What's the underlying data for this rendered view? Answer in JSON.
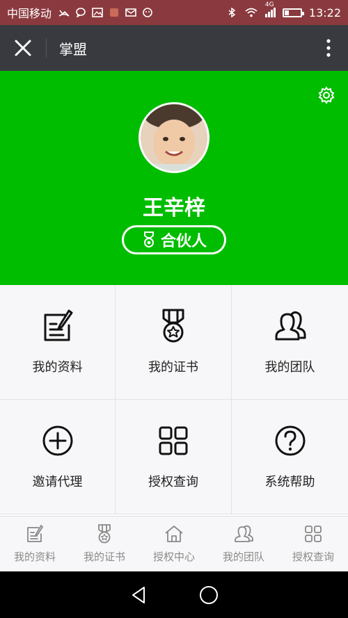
{
  "status_bar": {
    "carrier": "中国移动",
    "network": "4G",
    "time": "13:22",
    "battery_level": 0.25
  },
  "title_bar": {
    "title": "掌盟"
  },
  "profile": {
    "name": "王辛梓",
    "role": "合伙人",
    "hero_color": "#00bd00"
  },
  "grid": [
    {
      "label": "我的资料",
      "icon": "edit-icon"
    },
    {
      "label": "我的证书",
      "icon": "medal-icon"
    },
    {
      "label": "我的团队",
      "icon": "team-icon"
    },
    {
      "label": "邀请代理",
      "icon": "plus-circle-icon"
    },
    {
      "label": "授权查询",
      "icon": "grid-icon"
    },
    {
      "label": "系统帮助",
      "icon": "help-icon"
    }
  ],
  "tabs": [
    {
      "label": "我的资料",
      "icon": "edit-icon"
    },
    {
      "label": "我的证书",
      "icon": "medal-icon"
    },
    {
      "label": "授权中心",
      "icon": "home-icon"
    },
    {
      "label": "我的团队",
      "icon": "team-icon"
    },
    {
      "label": "授权查询",
      "icon": "grid-icon"
    }
  ]
}
